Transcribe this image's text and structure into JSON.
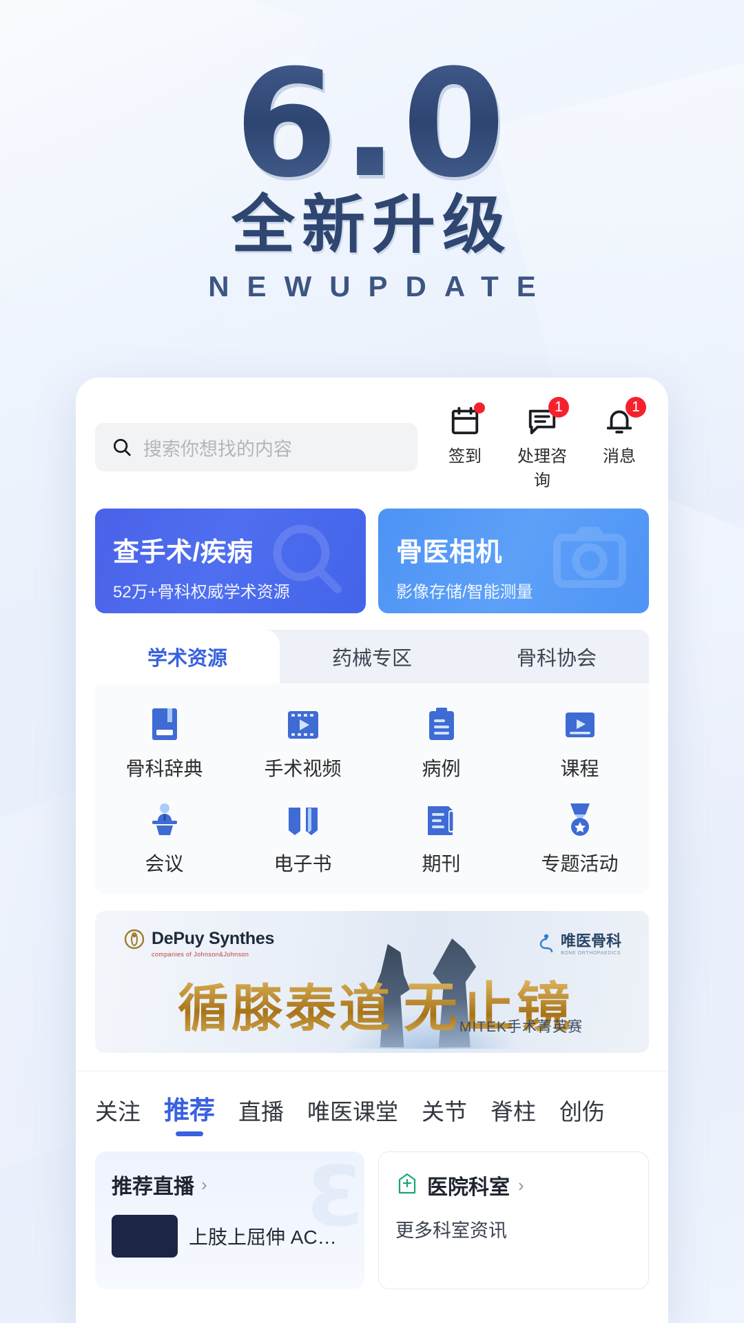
{
  "hero": {
    "version": "6.0",
    "title": "全新升级",
    "subtitle": "NEWUPDATE"
  },
  "search": {
    "placeholder": "搜索你想找的内容",
    "icon": "search-icon"
  },
  "top_actions": [
    {
      "label": "签到",
      "icon": "calendar-icon",
      "badge": "",
      "dot": true
    },
    {
      "label": "处理咨询",
      "icon": "chat-icon",
      "badge": "1",
      "dot": false
    },
    {
      "label": "消息",
      "icon": "bell-icon",
      "badge": "1",
      "dot": false
    }
  ],
  "promo_cards": [
    {
      "title": "查手术/疾病",
      "subtitle": "52万+骨科权威学术资源",
      "color": "#4a62e8"
    },
    {
      "title": "骨医相机",
      "subtitle": "影像存储/智能测量",
      "color": "#4e93f5"
    }
  ],
  "category_tabs": [
    {
      "label": "学术资源",
      "active": true
    },
    {
      "label": "药械专区",
      "active": false
    },
    {
      "label": "骨科协会",
      "active": false
    }
  ],
  "grid_items": [
    {
      "label": "骨科辞典",
      "icon": "book-icon"
    },
    {
      "label": "手术视频",
      "icon": "film-play-icon"
    },
    {
      "label": "病例",
      "icon": "clipboard-icon"
    },
    {
      "label": "课程",
      "icon": "video-slide-icon"
    },
    {
      "label": "会议",
      "icon": "podium-speaker-icon"
    },
    {
      "label": "电子书",
      "icon": "open-book-icon"
    },
    {
      "label": "期刊",
      "icon": "journal-icon"
    },
    {
      "label": "专题活动",
      "icon": "medal-icon"
    }
  ],
  "banner": {
    "sponsor_name": "DePuy Synthes",
    "sponsor_sub": "companies of Johnson&Johnson",
    "brand_name": "唯医骨科",
    "brand_sub": "BONE ORTHOPAEDICS",
    "headline_left": "循膝泰道",
    "headline_right": "无止镜",
    "event": "MITEK手术菁英赛"
  },
  "feed_tabs": [
    {
      "label": "关注",
      "active": false
    },
    {
      "label": "推荐",
      "active": true
    },
    {
      "label": "直播",
      "active": false
    },
    {
      "label": "唯医课堂",
      "active": false
    },
    {
      "label": "关节",
      "active": false
    },
    {
      "label": "脊柱",
      "active": false
    },
    {
      "label": "创伤",
      "active": false
    }
  ],
  "bottom_cards": {
    "left": {
      "title": "推荐直播",
      "chevron": "›",
      "item_text": "上肢上屈伸 ACDF手"
    },
    "right": {
      "title": "医院科室",
      "chevron": "›",
      "icon": "hospital-icon",
      "sub_text": "更多科室资讯"
    }
  },
  "colors": {
    "accent": "#3860e0",
    "badge": "#f5222d",
    "hero_text": "#2f4670"
  }
}
